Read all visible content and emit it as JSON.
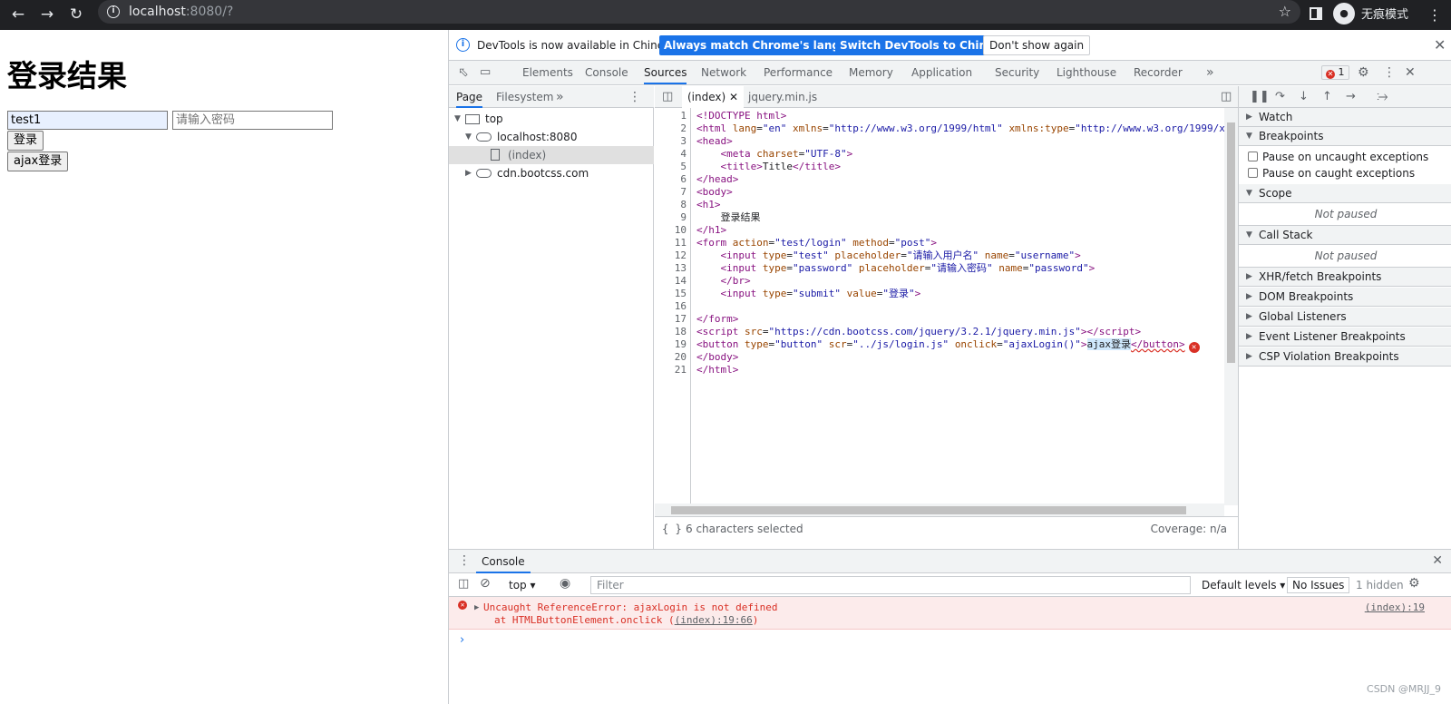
{
  "browser": {
    "url_host": "localhost",
    "url_rest": ":8080/?",
    "incognito_label": "无痕模式"
  },
  "page": {
    "heading": "登录结果",
    "username_value": "test1",
    "password_placeholder": "请输入密码",
    "login_button": "登录",
    "ajax_button": "ajax登录"
  },
  "devtools": {
    "infobar": {
      "text": "DevTools is now available in Chinese!",
      "match_button": "Always match Chrome's language",
      "switch_button": "Switch DevTools to Chinese",
      "dismiss_button": "Don't show again"
    },
    "tabs": [
      "Elements",
      "Console",
      "Sources",
      "Network",
      "Performance",
      "Memory",
      "Application",
      "Security",
      "Lighthouse",
      "Recorder"
    ],
    "active_tab": "Sources",
    "error_count": "1",
    "navigator": {
      "tabs": [
        "Page",
        "Filesystem"
      ],
      "tree": [
        "top",
        "localhost:8080",
        "(index)",
        "cdn.bootcss.com"
      ]
    },
    "editor": {
      "tabs": [
        "(index)",
        "jquery.min.js"
      ],
      "status_selected": "6 characters selected",
      "status_coverage": "Coverage: n/a"
    },
    "debugger": {
      "sections": [
        "Watch",
        "Breakpoints",
        "Scope",
        "Call Stack",
        "XHR/fetch Breakpoints",
        "DOM Breakpoints",
        "Global Listeners",
        "Event Listener Breakpoints",
        "CSP Violation Breakpoints"
      ],
      "pause_uncaught": "Pause on uncaught exceptions",
      "pause_caught": "Pause on caught exceptions",
      "not_paused": "Not paused"
    },
    "console": {
      "tab_label": "Console",
      "context": "top",
      "filter_placeholder": "Filter",
      "levels": "Default levels",
      "issues": "No Issues",
      "hidden": "1 hidden",
      "error_line1": "Uncaught ReferenceError: ajaxLogin is not defined",
      "error_line2_prefix": "at HTMLButtonElement.onclick (",
      "error_line2_link": "(index):19:66",
      "error_line2_suffix": ")",
      "error_source": "(index):19"
    },
    "watermark": "CSDN @MRJJ_9"
  }
}
